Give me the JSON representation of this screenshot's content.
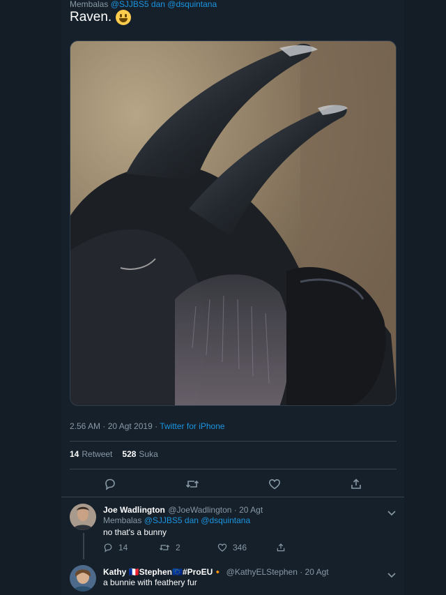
{
  "tweet": {
    "replying_prefix": "Membalas",
    "replying_handles": "@SJJBS5 dan @dsquintana",
    "text": "Raven.",
    "emoji": "grinning-face-emoji",
    "timestamp": "2.56 AM · 20 Agt 2019 · ",
    "source": "Twitter for iPhone",
    "retweets_count": "14",
    "retweets_label": "Retweet",
    "likes_count": "528",
    "likes_label": "Suka"
  },
  "replies": [
    {
      "name": "Joe Wadlington",
      "handle_time": "@JoeWadlington · 20 Agt",
      "replying_prefix": "Membalas",
      "replying_handles": "@SJJBS5 dan @dsquintana",
      "text": "no that's a bunny",
      "reply_count": "14",
      "retweet_count": "2",
      "like_count": "346"
    },
    {
      "name": "Kathy 🇫🇷Stephen🇪🇺#ProEU🔸",
      "handle_time": "@KathyELStephen · 20 Agt",
      "text": "a bunnie with feathery fur"
    }
  ],
  "colors": {
    "background": "#15202b",
    "outer": "#141d26",
    "link": "#1b95e0",
    "muted": "#8899a6",
    "divider": "#38444d"
  }
}
